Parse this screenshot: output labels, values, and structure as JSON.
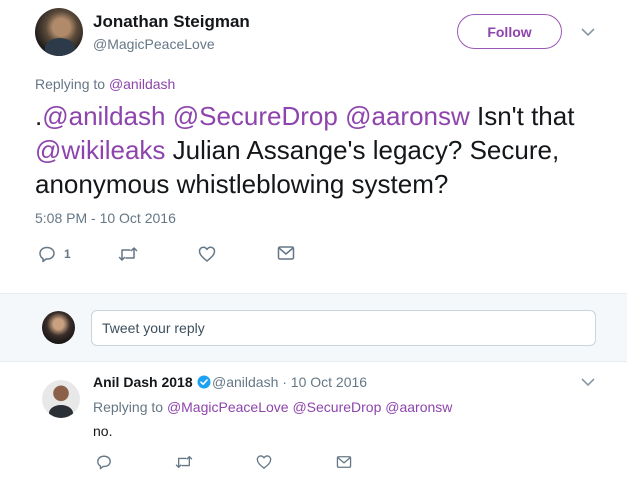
{
  "main_tweet": {
    "author_name": "Jonathan Steigman",
    "author_handle": "@MagicPeaceLove",
    "follow_label": "Follow",
    "replying_prefix": "Replying to ",
    "replying_handle": "@anildash",
    "text_parts": {
      "p0": ".",
      "m1": "@anildash",
      "m2": "@SecureDrop",
      "m3": "@aaronsw",
      "p1": " Isn't that ",
      "m4": "@wikileaks",
      "p2": " Julian Assange's legacy? Secure, anonymous whistleblowing system?"
    },
    "timestamp": "5:08 PM - 10 Oct 2016",
    "reply_count": "1"
  },
  "reply_box": {
    "placeholder": "Tweet your reply"
  },
  "reply_tweet": {
    "author_name": "Anil Dash 2018",
    "meta": "@anildash · 10 Oct 2016",
    "replying_prefix": "Replying to ",
    "replying_handles": {
      "h1": "@MagicPeaceLove",
      "h2": "@SecureDrop",
      "h3": "@aaronsw"
    },
    "text": "no."
  },
  "colors": {
    "accent": "#8e44ad",
    "verified": "#1da1f2",
    "muted": "#657786"
  },
  "icons": [
    "reply-icon",
    "retweet-icon",
    "like-icon",
    "message-icon",
    "chevron-down-icon",
    "verified-badge-icon"
  ]
}
